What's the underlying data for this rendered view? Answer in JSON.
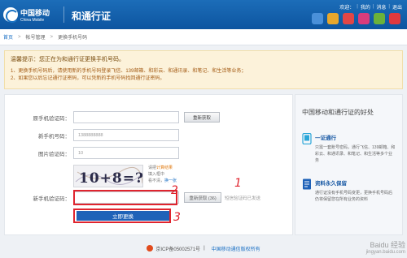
{
  "header": {
    "logo_cn": "中国移动",
    "logo_en": "China Mobile",
    "title": "和通行证",
    "welcome": "欢迎：",
    "nav": [
      "我的",
      "消息",
      "退出"
    ],
    "icons": [
      {
        "name": "139-mail-icon",
        "color": "#4a90d9"
      },
      {
        "name": "fetion-icon",
        "color": "#e8a72c"
      },
      {
        "name": "hecaiyun-icon",
        "color": "#e24646"
      },
      {
        "name": "hebiji-icon",
        "color": "#d93c7c"
      },
      {
        "name": "app-icon",
        "color": "#6bb23a"
      },
      {
        "name": "weibo-icon",
        "color": "#e0393e"
      }
    ]
  },
  "breadcrumb": {
    "home": "首页",
    "account": "帐号管理",
    "current": "更换手机号码"
  },
  "notice": {
    "title": "温馨提示：您正在为和通行证更换手机号码。",
    "line1": "1、更换手机号码后，请使用新的手机号码登录飞信、139邮箱、和彩云、和通讯录、和笔记、和生活等业务；",
    "line2": "2、如果您以后忘记通行证密码，可以凭新的手机号码找回通行证密码。"
  },
  "form": {
    "old_code_label": "原手机验证码：",
    "old_code_value": "",
    "old_code_btn": "重新获取",
    "new_phone_label": "新手机号码：",
    "new_phone_value": "1388888888",
    "captcha_label": "图片验证码：",
    "captcha_value": "10",
    "captcha_text": "10+8=?",
    "captcha_hint1_prefix": "请把",
    "captcha_hint1_highlight": "计算结果",
    "captcha_hint1_suffix": "填入框中",
    "captcha_hint2_prefix": "看不清，",
    "captcha_hint2_link": "换一张",
    "new_code_label": "新手机验证码：",
    "new_code_value": "",
    "resend_btn": "重新获取 (36)",
    "sent_hint": "短信验证码已发送",
    "submit_btn": "立即更换",
    "annotations": [
      "1",
      "2",
      "3"
    ]
  },
  "side": {
    "title": "中国移动和通行证的好处",
    "feature1_title": "一证通行",
    "feature1_desc": "只需一套账号密码，通行飞信、139邮箱、和彩云、和通讯录、和笔记、和生活等多个业务",
    "feature2_title": "资料永久保留",
    "feature2_desc": "通行证没有手机号码变更，更换手机号码后仍将保留您在所有业务的资料"
  },
  "footer": {
    "icp": "京ICP备05002571号",
    "sep": "|",
    "copyright": "中国移动通信版权所有"
  },
  "watermark": {
    "line1": "Baidu 经验",
    "line2": "jingyan.baidu.com"
  }
}
